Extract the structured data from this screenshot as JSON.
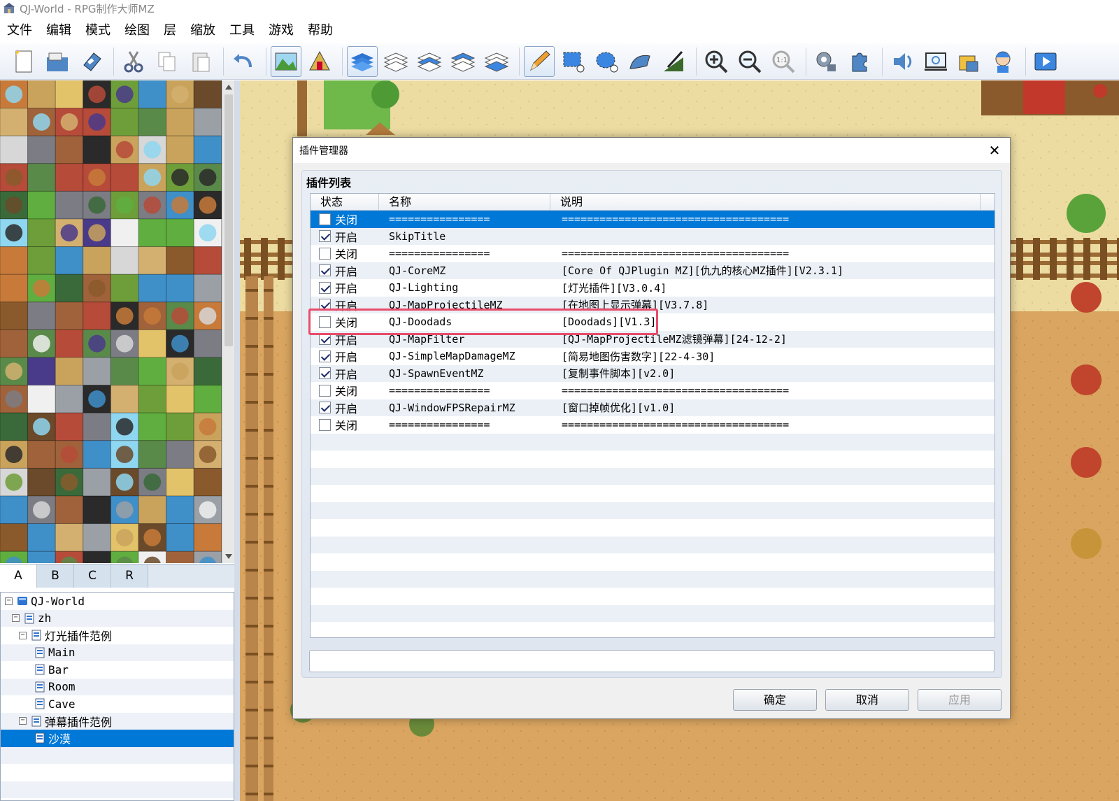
{
  "window": {
    "title": "QJ-World - RPG制作大师MZ"
  },
  "menu": [
    "文件",
    "编辑",
    "模式",
    "绘图",
    "层",
    "缩放",
    "工具",
    "游戏",
    "帮助"
  ],
  "toolbar": {
    "groups": [
      [
        "new-project-icon",
        "open-project-icon",
        "save-project-icon"
      ],
      [
        "cut-icon",
        "copy-icon",
        "paste-icon"
      ],
      [
        "undo-icon"
      ],
      [
        "map-mode-icon",
        "event-mode-icon"
      ],
      [
        "layer-auto-icon",
        "layer-1-icon",
        "layer-2-icon",
        "layer-3-icon",
        "layer-4-icon"
      ],
      [
        "pencil-icon",
        "rectangle-icon",
        "ellipse-icon",
        "fill-icon",
        "shadow-pen-icon"
      ],
      [
        "zoom-in-icon",
        "zoom-out-icon",
        "zoom-actual-icon"
      ],
      [
        "database-icon",
        "plugin-manager-icon"
      ],
      [
        "sound-test-icon",
        "event-searcher-icon",
        "resource-manager-icon",
        "character-generator-icon"
      ],
      [
        "playtest-icon"
      ]
    ]
  },
  "tileset_tabs": [
    "A",
    "B",
    "C",
    "R"
  ],
  "map_tree": [
    {
      "label": "QJ-World",
      "indent": 0,
      "toggle": "⊟"
    },
    {
      "label": "zh",
      "indent": 1,
      "toggle": "⊟"
    },
    {
      "label": "灯光插件范例",
      "indent": 2,
      "toggle": "⊟"
    },
    {
      "label": "Main",
      "indent": 3,
      "toggle": ""
    },
    {
      "label": "Bar",
      "indent": 3,
      "toggle": ""
    },
    {
      "label": "Room",
      "indent": 3,
      "toggle": ""
    },
    {
      "label": "Cave",
      "indent": 3,
      "toggle": ""
    },
    {
      "label": "弹幕插件范例",
      "indent": 2,
      "toggle": "⊟"
    },
    {
      "label": "沙漠",
      "indent": 3,
      "toggle": "",
      "selected": true
    }
  ],
  "dialog": {
    "title": "插件管理器",
    "panel_title": "插件列表",
    "columns": {
      "status": "状态",
      "name": "名称",
      "description": "说明"
    },
    "plugins": [
      {
        "checked": false,
        "status": "关闭",
        "name": "================",
        "description": "====================================",
        "selected": true
      },
      {
        "checked": true,
        "status": "开启",
        "name": "SkipTitle",
        "description": ""
      },
      {
        "checked": false,
        "status": "关闭",
        "name": "================",
        "description": "===================================="
      },
      {
        "checked": true,
        "status": "开启",
        "name": "QJ-CoreMZ",
        "description": "[Core Of QJPlugin MZ][仇九的核心MZ插件][V2.3.1]"
      },
      {
        "checked": true,
        "status": "开启",
        "name": "QJ-Lighting",
        "description": "[灯光插件][V3.0.4]"
      },
      {
        "checked": true,
        "status": "开启",
        "name": "QJ-MapProjectileMZ",
        "description": "[在地图上显示弹幕][V3.7.8]"
      },
      {
        "checked": false,
        "status": "关闭",
        "name": "QJ-Doodads",
        "description": "[Doodads][V1.3]"
      },
      {
        "checked": true,
        "status": "开启",
        "name": "QJ-MapFilter",
        "description": "[QJ-MapProjectileMZ滤镜弹幕][24-12-2]"
      },
      {
        "checked": true,
        "status": "开启",
        "name": "QJ-SimpleMapDamageMZ",
        "description": "[简易地图伤害数字][22-4-30]"
      },
      {
        "checked": true,
        "status": "开启",
        "name": "QJ-SpawnEventMZ",
        "description": "[复制事件脚本][v2.0]"
      },
      {
        "checked": false,
        "status": "关闭",
        "name": "================",
        "description": "===================================="
      },
      {
        "checked": true,
        "status": "开启",
        "name": "QJ-WindowFPSRepairMZ",
        "description": "[窗口掉帧优化][v1.0]"
      },
      {
        "checked": false,
        "status": "关闭",
        "name": "================",
        "description": "===================================="
      }
    ],
    "buttons": {
      "ok": "确定",
      "cancel": "取消",
      "apply": "应用"
    }
  },
  "colors": {
    "selection": "#0078d7",
    "highlight": "#e84c6a",
    "map_sand": "#e8d89a"
  }
}
